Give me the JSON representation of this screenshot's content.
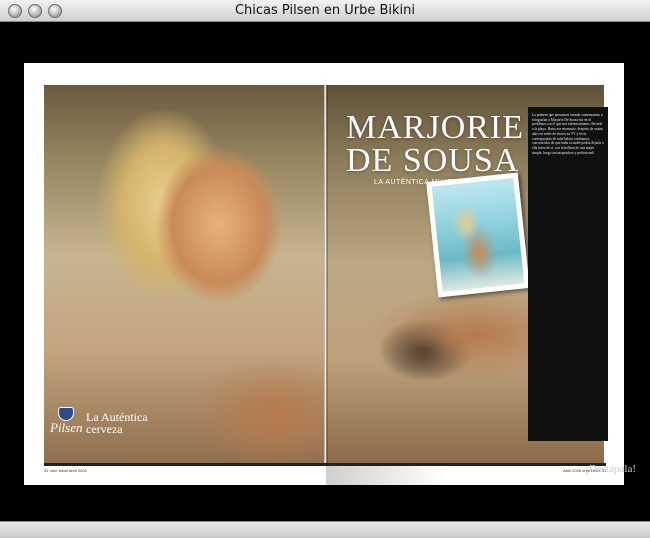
{
  "window": {
    "title": "Chicas Pilsen en Urbe Bikini"
  },
  "magazine": {
    "headline_line1": "MARJORIE",
    "headline_line2": "DE SOUSA",
    "deck": "LA AUTÉNTICA MUJER",
    "brand": "Pilsen",
    "tagline_line1": "La Auténtica",
    "tagline_line2": "cerveza",
    "article_text": "La primera que pensamos cuando comenzamos a fotografiar a Marjorie De Sousa era en el problema con el que nos enfrentaríamos: llevarla a la playa. Hasta ese momento, después de cuatro años en miles de shows en TV y en la contraportada de urbe bikini, estábamos convencidos de que nada ni nadie podría dejarla a ella fuera de sí, con la belleza de una mujer simple, luego tan inspiradora y profesional.",
    "page_left": "32",
    "page_right": "33",
    "page_left_caption": "urbe bikini Abril 2006",
    "page_right_caption": "Abril 2006 urbe bikini"
  },
  "caption": "¡Destápala!",
  "colors": {
    "background": "#000000",
    "titlebar": "#dcdcdc",
    "article_bg": "#111111"
  }
}
